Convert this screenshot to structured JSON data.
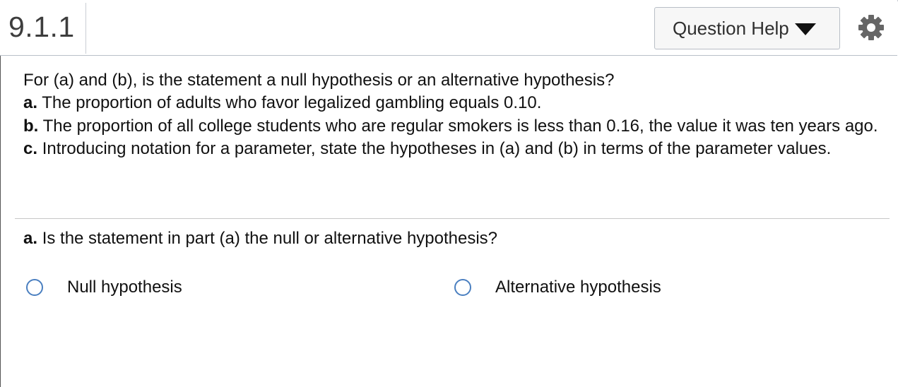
{
  "header": {
    "question_number": "9.1.1",
    "help_button_label": "Question Help",
    "help_icon": "caret-down-icon",
    "settings_icon": "gear-icon"
  },
  "question": {
    "intro": "For (a) and (b), is the statement a null hypothesis or an alternative hypothesis?",
    "items": [
      {
        "marker": "a.",
        "text": "The proportion of adults who favor legalized gambling equals 0.10."
      },
      {
        "marker": "b.",
        "text": "The proportion of all college students who are regular smokers is less than 0.16, the value it was ten years ago."
      },
      {
        "marker": "c.",
        "text": "Introducing notation for a parameter, state the hypotheses in (a) and (b) in terms of the parameter values."
      }
    ]
  },
  "part_a": {
    "marker": "a.",
    "prompt": "Is the statement in part (a) the null or alternative hypothesis?",
    "options": [
      {
        "label": "Null hypothesis",
        "selected": false
      },
      {
        "label": "Alternative hypothesis",
        "selected": false
      }
    ]
  },
  "colors": {
    "radio_border": "#4a7fc0",
    "header_border": "#b9c0c8",
    "help_button_background": "#f7f7f7"
  }
}
